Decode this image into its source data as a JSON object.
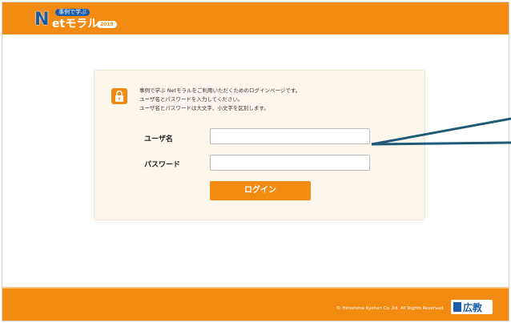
{
  "header": {
    "logo_sub": "事例で学ぶ",
    "logo_n": "N",
    "logo_main": "etモラル",
    "logo_year": "2019"
  },
  "login": {
    "info_lines": [
      "事例で学ぶ Netモラルをご利用いただくためのログインページです。",
      "ユーザ名とパスワードを入力してください。",
      "ユーザ名とパスワードは大文字、小文字を区別します。"
    ],
    "username_label": "ユーザ名",
    "password_label": "パスワード",
    "username_value": "",
    "password_value": "",
    "login_button": "ログイン"
  },
  "footer": {
    "copyright": "© Hiroshima Kyohan Co.,ltd. All Rights Reserved.",
    "brand": "広教"
  },
  "colors": {
    "accent": "#f38a12",
    "brand_blue": "#1b5da8",
    "panel_bg": "#fdf6ec",
    "annotation_line": "#1f5a76"
  },
  "icons": {
    "lock": "lock-icon"
  }
}
